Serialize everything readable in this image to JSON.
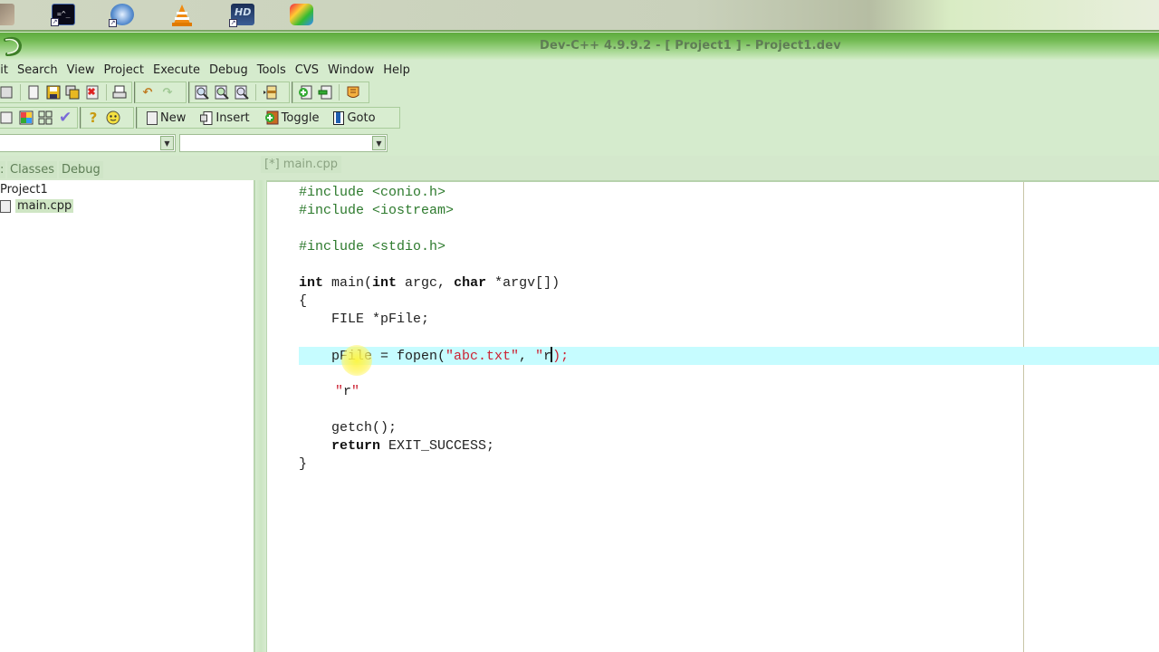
{
  "taskbar": {
    "quick_launch": [
      {
        "name": "app-shortcut-1",
        "icon": "game-icon"
      },
      {
        "name": "command-prompt-shortcut",
        "icon": "console-icon"
      },
      {
        "name": "dvd-shortcut",
        "icon": "dvd-icon"
      },
      {
        "name": "vlc-shortcut",
        "icon": "vlc-cone-icon"
      },
      {
        "name": "hd-video-shortcut",
        "icon": "hd-icon"
      },
      {
        "name": "paint-shortcut",
        "icon": "paint-icon"
      }
    ]
  },
  "window": {
    "title": "Dev-C++ 4.9.9.2  -  [ Project1 ] - Project1.dev"
  },
  "menubar": {
    "items": [
      "dit",
      "Search",
      "View",
      "Project",
      "Execute",
      "Debug",
      "Tools",
      "CVS",
      "Window",
      "Help"
    ]
  },
  "toolbar2": {
    "new_label": "New",
    "insert_label": "Insert",
    "toggle_label": "Toggle",
    "goto_label": "Goto"
  },
  "combos": {
    "class_value": "",
    "member_value": ""
  },
  "left_panel": {
    "tabs": [
      "Classes",
      "Debug"
    ],
    "tree": {
      "project": "Project1",
      "files": [
        "main.cpp"
      ]
    }
  },
  "editor": {
    "tab_label": "[*] main.cpp",
    "lines": {
      "l1_dir": "#include",
      "l1_arg": "<conio.h>",
      "l2_dir": "#include",
      "l2_arg": "<iostream>",
      "l4_dir": "#include",
      "l4_arg": "<stdio.h>",
      "l6_kw1": "int",
      "l6_a": " main(",
      "l6_kw2": "int",
      "l6_b": " argc, ",
      "l6_kw3": "char",
      "l6_c": " *argv[])",
      "l7": "{",
      "l8": "    FILE *pFile;",
      "l10_a": "    pFile = fopen(",
      "l10_s1": "\"abc.txt\"",
      "l10_b": ", ",
      "l10_s2a": "\"",
      "l10_s2b": "r",
      "l10_c": ");",
      "l12_q1": "\"",
      "l12_r": "r",
      "l12_q2": "\"",
      "l14": "    getch();",
      "l15_kw": "return",
      "l15_rest": " EXIT_SUCCESS;",
      "l16": "}"
    }
  },
  "colors": {
    "title_bar": "#5eab3e",
    "chrome_bg": "#d5ebcd",
    "current_line": "#c6fcff",
    "string": "#cc2233",
    "preprocessor": "#2d7a2d"
  }
}
